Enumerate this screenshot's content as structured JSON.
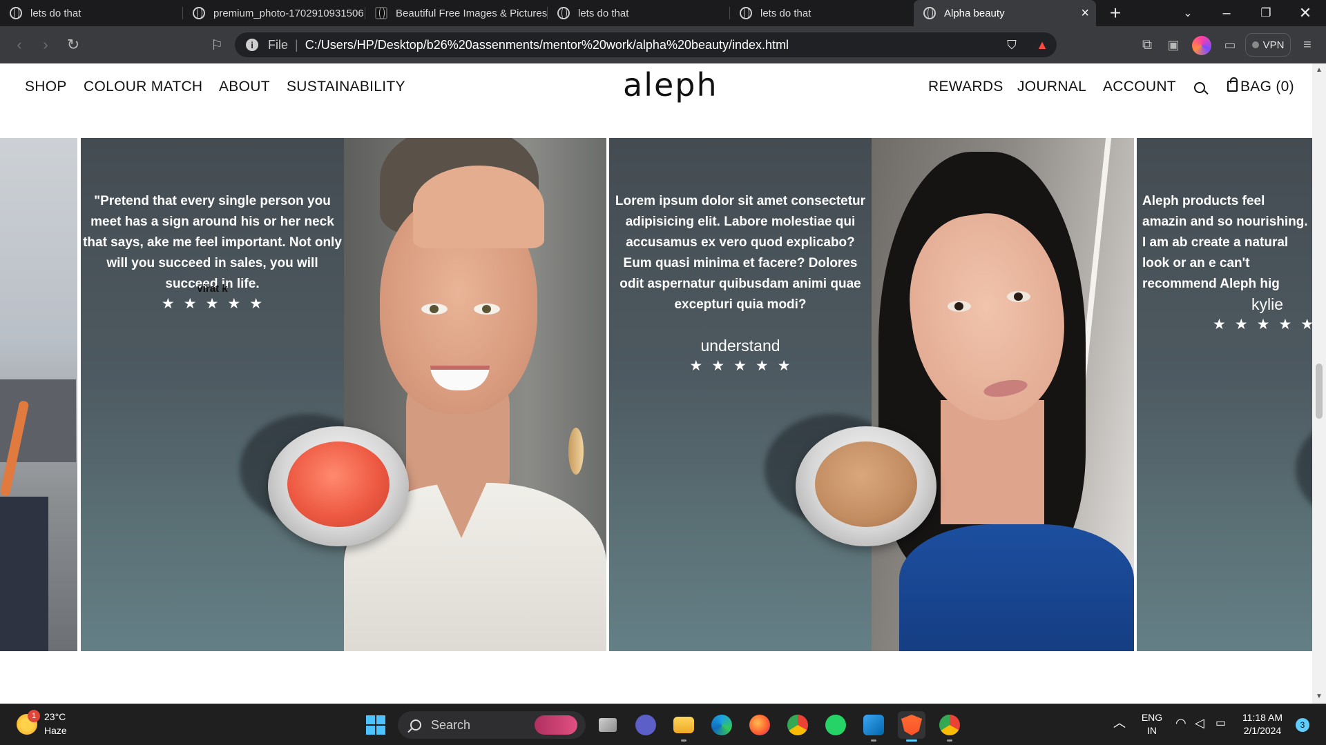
{
  "browser": {
    "tabs": [
      {
        "title": "lets do that"
      },
      {
        "title": "premium_photo-1702910931506"
      },
      {
        "title": "Beautiful Free Images & Pictures"
      },
      {
        "title": "lets do that"
      },
      {
        "title": "lets do that"
      },
      {
        "title": "Alpha beauty"
      }
    ],
    "address": {
      "scheme_label": "File",
      "url": "C:/Users/HP/Desktop/b26%20assenments/mentor%20work/alpha%20beauty/index.html"
    },
    "vpn_label": "VPN"
  },
  "site": {
    "logo": "aleph",
    "nav_left": [
      "SHOP",
      "COLOUR MATCH",
      "ABOUT",
      "SUSTAINABILITY"
    ],
    "nav_right": [
      "REWARDS",
      "JOURNAL",
      "ACCOUNT"
    ],
    "bag_label": "BAG (0)"
  },
  "testimonials": [
    {
      "quote": "\"Pretend that every single person you meet has a sign around his or her neck that says, ake me feel important. Not only will you succeed in sales, you will succeed in life.",
      "author": "virat k",
      "stars": "★★★★★",
      "rating": 5
    },
    {
      "quote": "Lorem ipsum dolor sit amet consectetur adipisicing elit. Labore molestiae qui accusamus ex vero quod explicabo? Eum quasi minima et facere? Dolores odit aspernatur quibusdam animi quae excepturi quia modi?",
      "author": "understand",
      "stars": "★★★★★",
      "rating": 5
    },
    {
      "quote": "Aleph products feel amazin and so nourishing. I am ab create a natural look or an e can't recommend Aleph hig",
      "author": "kylie",
      "stars": "★★★★★",
      "rating": 5
    }
  ],
  "products": [
    {
      "name": "coral-pot",
      "color": "#ee5a43"
    },
    {
      "name": "nude-pot",
      "color": "#c38d62"
    }
  ],
  "taskbar": {
    "weather_temp": "23°C",
    "weather_desc": "Haze",
    "weather_badge": "1",
    "search_label": "Search",
    "lang_top": "ENG",
    "lang_bottom": "IN",
    "time": "11:18 AM",
    "date": "2/1/2024",
    "notifications": "3"
  }
}
